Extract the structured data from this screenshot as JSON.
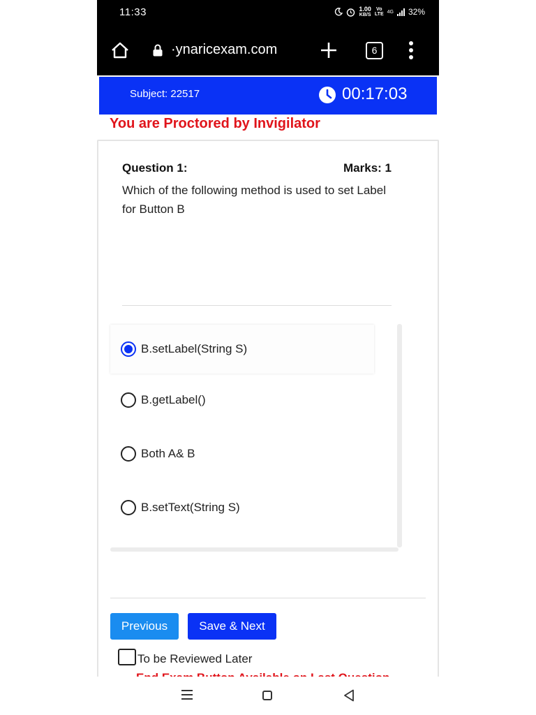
{
  "status_bar": {
    "time": "11:33",
    "net_speed_value": "1.00",
    "net_speed_unit": "KB/S",
    "volte_top": "Vo",
    "volte_bottom": "LTE",
    "network": "4G",
    "battery": "32%"
  },
  "browser": {
    "url": "·ynaricexam.com",
    "tab_count": "6"
  },
  "exam_header": {
    "subject": "Subject: 22517",
    "timer": "00:17:03",
    "accent_color": "#0a32f5"
  },
  "proctor_notice": "You are Proctored by Invigilator",
  "question": {
    "number_label": "Question 1:",
    "marks_label": "Marks: 1",
    "text": "Which of the following method is used to set Label for Button B"
  },
  "options": [
    {
      "label": "B.setLabel(String S)",
      "selected": true
    },
    {
      "label": "B.getLabel()",
      "selected": false
    },
    {
      "label": "Both A& B",
      "selected": false
    },
    {
      "label": "B.setText(String S)",
      "selected": false
    }
  ],
  "buttons": {
    "previous": "Previous",
    "save_next": "Save & Next"
  },
  "review_later_label": "To be Reviewed Later",
  "end_exam_note": "End Exam Button Available on Last Question",
  "icons": [
    "home-icon",
    "lock-icon",
    "plus-icon",
    "tabs-icon",
    "menu-icon",
    "clock-icon",
    "nav-menu-icon",
    "nav-home-icon",
    "nav-back-icon"
  ]
}
